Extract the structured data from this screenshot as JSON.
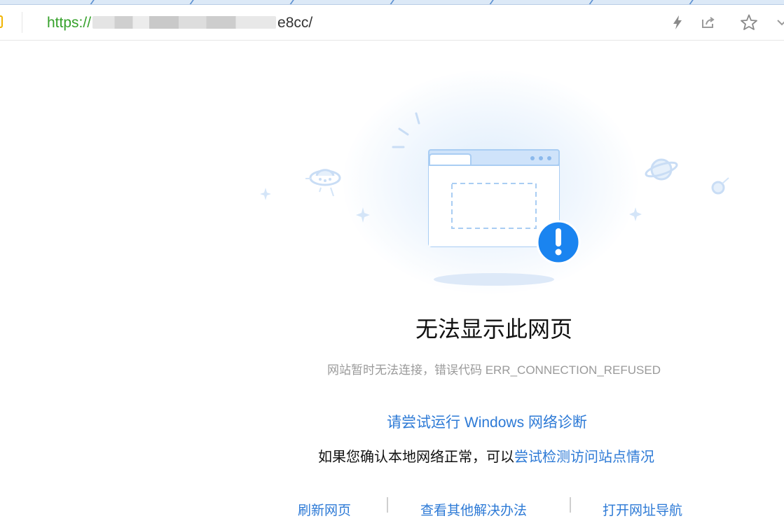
{
  "address_bar": {
    "url_scheme": "https://",
    "url_tail": "e8cc/"
  },
  "colors": {
    "accent_blue": "#2d7ad6",
    "alert_blue": "#1a84f0",
    "url_green": "#36a12b"
  },
  "toolbar_icons": [
    "lightning-icon",
    "share-icon",
    "star-icon",
    "chevron-icon"
  ],
  "error": {
    "title": "无法显示此网页",
    "subtitle": "网站暂时无法连接，错误代码 ERR_CONNECTION_REFUSED",
    "diagnose_link": "请尝试运行 Windows 网络诊断",
    "line2_prefix": "如果您确认本地网络正常，可以",
    "line2_link": "尝试检测访问站点情况"
  },
  "bottom_links": {
    "refresh": "刷新网页",
    "other_solutions": "查看其他解决办法",
    "open_nav": "打开网址导航"
  }
}
